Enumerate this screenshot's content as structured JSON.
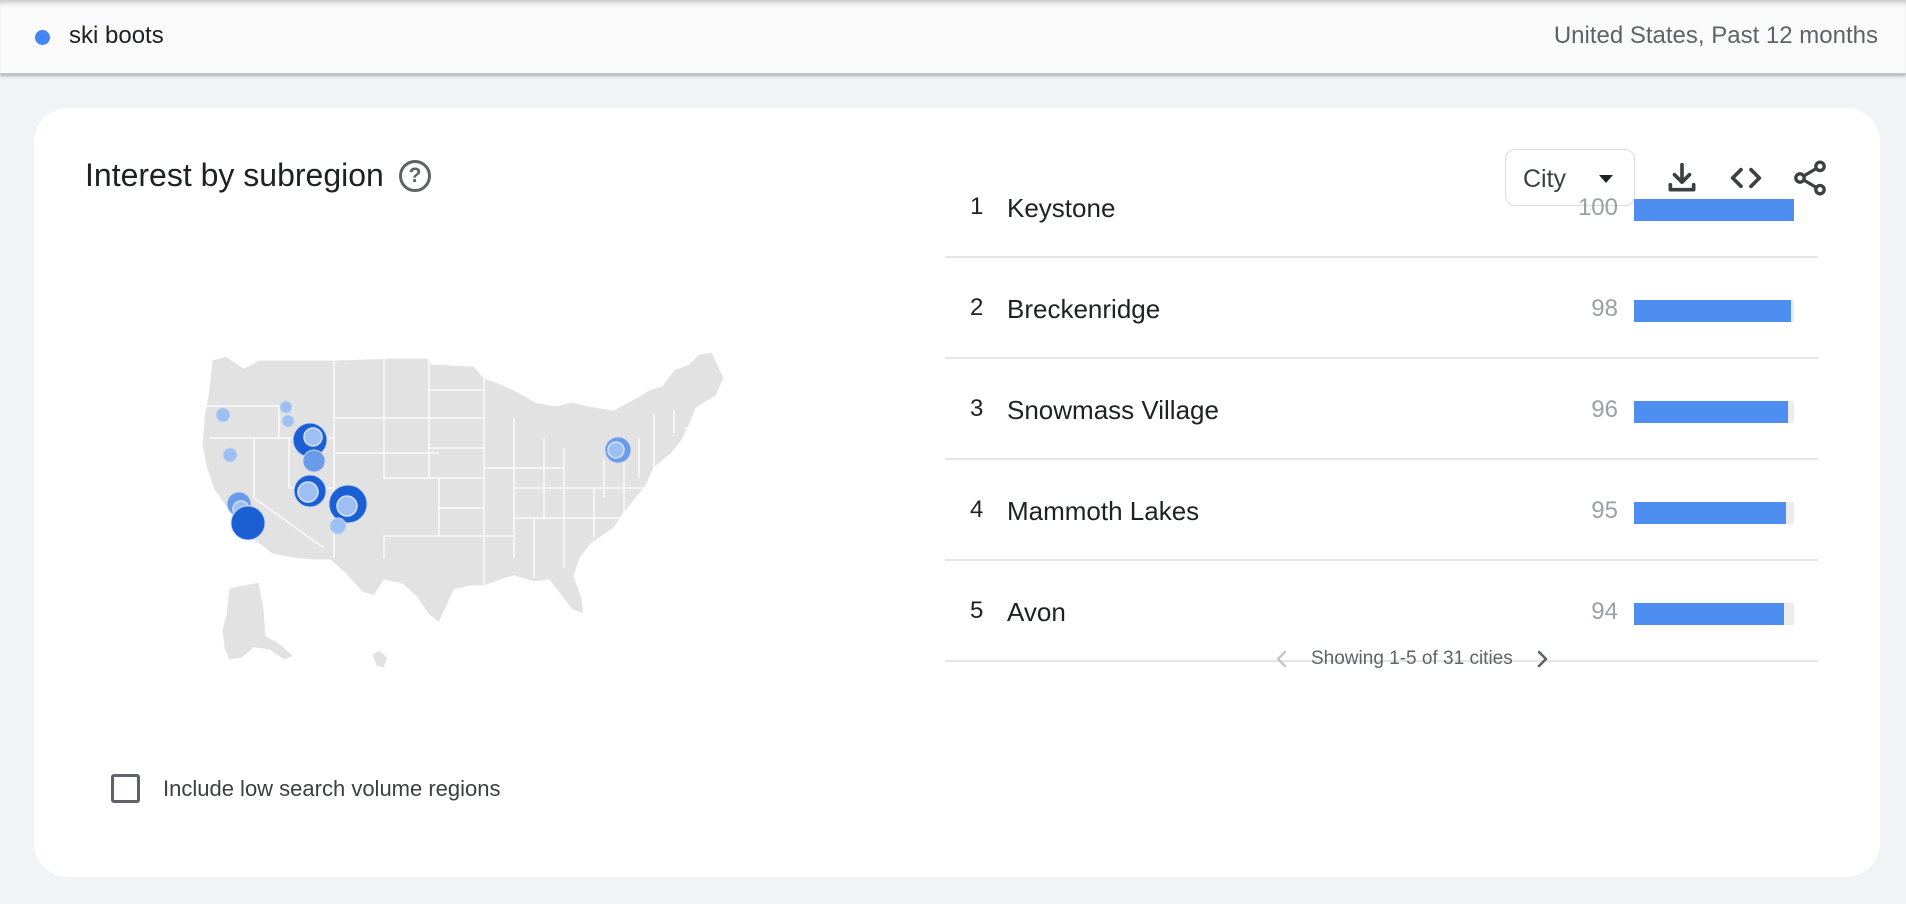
{
  "header": {
    "search_term": "ski boots",
    "term_color": "#4285f4",
    "scope": "United States, Past 12 months"
  },
  "card": {
    "title": "Interest by subregion",
    "help_icon": "help-circle-icon",
    "resolution_select": {
      "selected": "City"
    },
    "toolbar_icons": [
      "download-icon",
      "embed-code-icon",
      "share-icon"
    ],
    "include_low_volume": {
      "label": "Include low search volume regions",
      "checked": false
    }
  },
  "map": {
    "region": "United States",
    "bubbles": [
      {
        "area": "Seattle area, WA",
        "intensity": "low"
      },
      {
        "area": "Bend area, OR",
        "intensity": "low"
      },
      {
        "area": "Northern Idaho",
        "intensity": "low"
      },
      {
        "area": "Western Montana",
        "intensity": "low"
      },
      {
        "area": "Big Sky, MT",
        "intensity": "high"
      },
      {
        "area": "Jackson, WY",
        "intensity": "medium"
      },
      {
        "area": "Park City, UT",
        "intensity": "high"
      },
      {
        "area": "Lake Tahoe, CA",
        "intensity": "medium"
      },
      {
        "area": "Mammoth Lakes, CA",
        "intensity": "high"
      },
      {
        "area": "Summit County, CO",
        "intensity": "high"
      },
      {
        "area": "Telluride, CO",
        "intensity": "low"
      },
      {
        "area": "Lake Placid, NY / Vermont",
        "intensity": "medium"
      }
    ],
    "colors": {
      "high": "#1a5fd4",
      "medium": "#6a9be8",
      "low": "#9dbff3",
      "land": "#e2e2e2"
    }
  },
  "ranking": {
    "items": [
      {
        "rank": "1",
        "name": "Keystone",
        "value": "100",
        "fraction": 1.0
      },
      {
        "rank": "2",
        "name": "Breckenridge",
        "value": "98",
        "fraction": 0.98
      },
      {
        "rank": "3",
        "name": "Snowmass Village",
        "value": "96",
        "fraction": 0.96
      },
      {
        "rank": "4",
        "name": "Mammoth Lakes",
        "value": "95",
        "fraction": 0.95
      },
      {
        "rank": "5",
        "name": "Avon",
        "value": "94",
        "fraction": 0.94
      }
    ],
    "bar_color": "#4e8ef0",
    "pagination": "Showing 1-5 of 31 cities"
  }
}
